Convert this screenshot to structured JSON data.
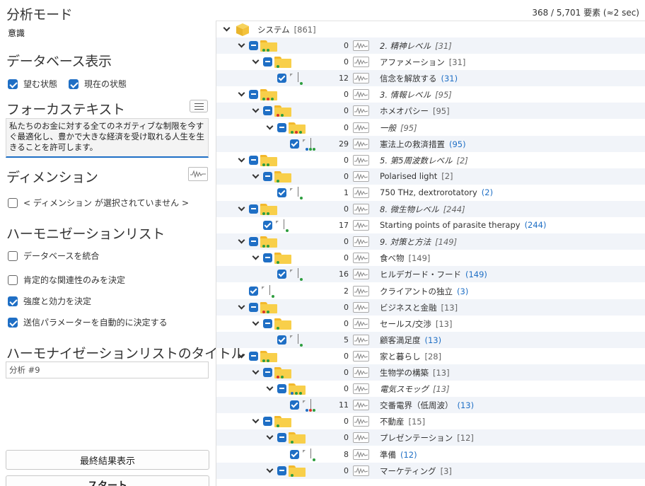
{
  "analysis_mode": {
    "title": "分析モード",
    "value": "意識"
  },
  "database_display": {
    "title": "データベース表示",
    "options": [
      {
        "label": "望む状態",
        "checked": true
      },
      {
        "label": "現在の状態",
        "checked": true
      }
    ]
  },
  "focus_text": {
    "title": "フォーカステキスト",
    "value": "私たちのお金に対する全てのネガティブな制限を今すぐ最適化し、豊かで大きな経済を受け取れる人生を生きることを許可します。"
  },
  "dimension": {
    "title": "ディメンション",
    "none_label": "< ディメンション が選択されていません >"
  },
  "harmonization_list": {
    "title": "ハーモニゼーションリスト",
    "options": [
      {
        "label": "データベースを統合",
        "checked": false
      },
      {
        "label": "肯定的な関連性のみを決定",
        "checked": false
      },
      {
        "label": "強度と効力を決定",
        "checked": true
      },
      {
        "label": "送信パラメーターを自動的に決定する",
        "checked": true
      }
    ]
  },
  "list_title": {
    "title": "ハーモナイゼーションリストのタイトル",
    "value": "分析 #9"
  },
  "buttons": {
    "final_results": "最終結果表示",
    "start": "スタート"
  },
  "count_text": "368 / 5,701 要素 (≈2 sec)",
  "colors": {
    "accent": "#1f6fc5",
    "folder": "#f8cf4a",
    "row_alt": "#f1f4f9"
  },
  "tree": {
    "root": {
      "label": "システム",
      "count": "[861]"
    },
    "rows": [
      {
        "level": 1,
        "kind": "folder",
        "dots": [
          "#2e9e3f",
          "#2e9e3f"
        ],
        "num": "0",
        "label": "2. 精神レベル",
        "italic": true,
        "count": "[31]",
        "blue": false
      },
      {
        "level": 2,
        "kind": "folder",
        "dots": [
          "#2e9e3f"
        ],
        "num": "0",
        "label": "アファメーション",
        "italic": false,
        "count": "[31]",
        "blue": false
      },
      {
        "level": 3,
        "kind": "leaf",
        "dots": [
          "#2e9e3f"
        ],
        "num": "12",
        "label": "信念を解放する",
        "italic": false,
        "count": "(31)",
        "blue": true
      },
      {
        "level": 1,
        "kind": "folder",
        "dots": [
          "#2e9e3f",
          "#d9342b",
          "#2e9e3f"
        ],
        "num": "0",
        "label": "3. 情報レベル",
        "italic": true,
        "count": "[95]",
        "blue": false
      },
      {
        "level": 2,
        "kind": "folder",
        "dots": [
          "#d9342b",
          "#2e9e3f"
        ],
        "num": "0",
        "label": "ホメオパシー",
        "italic": false,
        "count": "[95]",
        "blue": false
      },
      {
        "level": 3,
        "kind": "folder",
        "dots": [
          "#2e9e3f",
          "#d9342b",
          "#2e9e3f"
        ],
        "num": "0",
        "label": "一般",
        "italic": true,
        "count": "[95]",
        "blue": false
      },
      {
        "level": 4,
        "kind": "leaf",
        "dots": [
          "#1f6fc5",
          "#2e9e3f",
          "#2e9e3f"
        ],
        "num": "29",
        "label": "憲法上の救済措置",
        "italic": false,
        "count": "(95)",
        "blue": true
      },
      {
        "level": 1,
        "kind": "folder",
        "dots": [
          "#2e9e3f",
          "#2e9e3f"
        ],
        "num": "0",
        "label": "5. 第5周波数レベル",
        "italic": true,
        "count": "[2]",
        "blue": false
      },
      {
        "level": 2,
        "kind": "folder",
        "dots": [
          "#2e9e3f"
        ],
        "num": "0",
        "label": "Polarised light",
        "italic": false,
        "count": "[2]",
        "blue": false
      },
      {
        "level": 3,
        "kind": "leaf",
        "dots": [
          "#2e9e3f"
        ],
        "num": "1",
        "label": "750 THz, dextrorotatory",
        "italic": false,
        "count": "(2)",
        "blue": true
      },
      {
        "level": 1,
        "kind": "folder",
        "dots": [
          "#2e9e3f",
          "#2e9e3f"
        ],
        "num": "0",
        "label": "8. 微生物レベル",
        "italic": true,
        "count": "[244]",
        "blue": false
      },
      {
        "level": 2,
        "kind": "leaf",
        "dots": [
          "#2e9e3f"
        ],
        "num": "17",
        "label": "Starting points of parasite therapy",
        "italic": false,
        "count": "(244)",
        "blue": true
      },
      {
        "level": 1,
        "kind": "folder",
        "dots": [
          "#2e9e3f",
          "#2e9e3f"
        ],
        "num": "0",
        "label": "9. 対策と方法",
        "italic": true,
        "count": "[149]",
        "blue": false
      },
      {
        "level": 2,
        "kind": "folder",
        "dots": [
          "#2e9e3f"
        ],
        "num": "0",
        "label": "食べ物",
        "italic": false,
        "count": "[149]",
        "blue": false
      },
      {
        "level": 3,
        "kind": "leaf",
        "dots": [
          "#2e9e3f"
        ],
        "num": "16",
        "label": "ヒルデガード・フード",
        "italic": false,
        "count": "(149)",
        "blue": true
      },
      {
        "level": 1,
        "kind": "leaf",
        "dots": [
          "#2e9e3f"
        ],
        "num": "2",
        "label": "クライアントの独立",
        "italic": false,
        "count": "(3)",
        "blue": true
      },
      {
        "level": 1,
        "kind": "folder",
        "dots": [
          "#d9342b",
          "#2e9e3f"
        ],
        "num": "0",
        "label": "ビジネスと金融",
        "italic": false,
        "count": "[13]",
        "blue": false
      },
      {
        "level": 2,
        "kind": "folder",
        "dots": [
          "#2e9e3f"
        ],
        "num": "0",
        "label": "セールス/交渉",
        "italic": false,
        "count": "[13]",
        "blue": false
      },
      {
        "level": 3,
        "kind": "leaf",
        "dots": [
          "#2e9e3f"
        ],
        "num": "5",
        "label": "顧客満足度",
        "italic": false,
        "count": "(13)",
        "blue": true
      },
      {
        "level": 1,
        "kind": "folder",
        "dots": [
          "#2e9e3f",
          "#2e9e3f"
        ],
        "num": "0",
        "label": "家と暮らし",
        "italic": false,
        "count": "[28]",
        "blue": false
      },
      {
        "level": 2,
        "kind": "folder",
        "dots": [
          "#d9342b",
          "#2e9e3f"
        ],
        "num": "0",
        "label": "生物学の構築",
        "italic": false,
        "count": "[13]",
        "blue": false
      },
      {
        "level": 3,
        "kind": "folder",
        "dots": [
          "#1f6fc5",
          "#2e9e3f",
          "#2e9e3f"
        ],
        "num": "0",
        "label": "電気スモッグ",
        "italic": true,
        "count": "[13]",
        "blue": false
      },
      {
        "level": 4,
        "kind": "leaf",
        "dots": [
          "#1f6fc5",
          "#d9342b",
          "#2e9e3f"
        ],
        "num": "11",
        "label": "交番電界（低周波）",
        "italic": false,
        "count": "(13)",
        "blue": true
      },
      {
        "level": 2,
        "kind": "folder",
        "dots": [
          "#2e9e3f"
        ],
        "num": "0",
        "label": "不動産",
        "italic": false,
        "count": "[15]",
        "blue": false
      },
      {
        "level": 3,
        "kind": "folder",
        "dots": [
          "#2e9e3f"
        ],
        "num": "0",
        "label": "プレゼンテーション",
        "italic": false,
        "count": "[12]",
        "blue": false
      },
      {
        "level": 4,
        "kind": "leaf",
        "dots": [
          "#2e9e3f"
        ],
        "num": "8",
        "label": "準備",
        "italic": false,
        "count": "(12)",
        "blue": true
      },
      {
        "level": 3,
        "kind": "folder",
        "dots": [
          "#2e9e3f"
        ],
        "num": "0",
        "label": "マーケティング",
        "italic": false,
        "count": "[3]",
        "blue": false
      }
    ]
  }
}
